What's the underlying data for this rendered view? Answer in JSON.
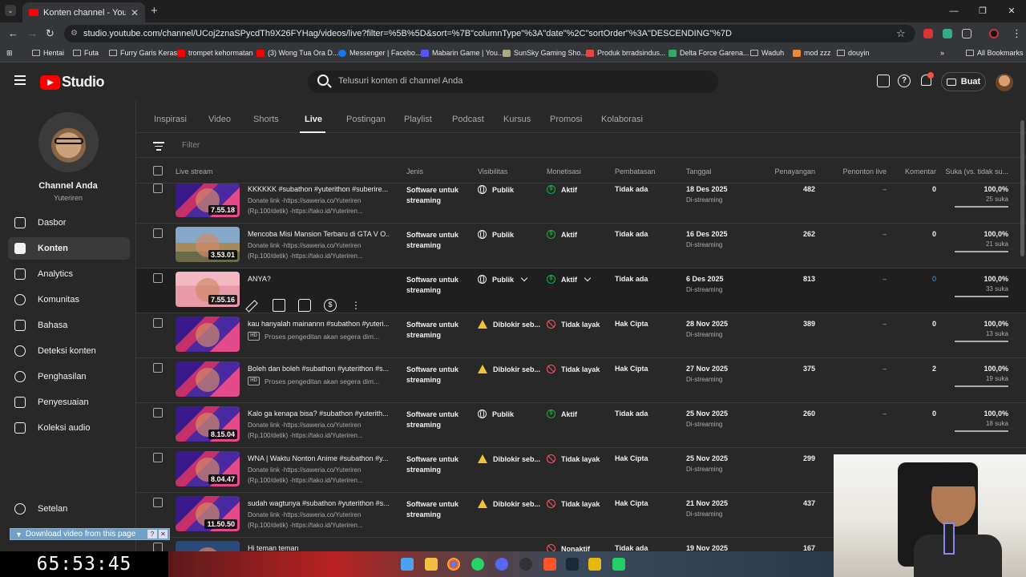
{
  "browser": {
    "tab_title": "Konten channel - YouTube Studio",
    "tab_close": "✕",
    "new_tab": "+",
    "url": "studio.youtube.com/channel/UCoj2znaSPycdTh9X26FYHag/videos/live?filter=%5B%5D&sort=%7B\"columnType\"%3A\"date\"%2C\"sortOrder\"%3A\"DESCENDING\"%7D",
    "bookmarks": [
      "Hentai",
      "Futa",
      "Furry Garis Keras",
      "trompet kehormatan",
      "(3) Wong Tua Ora D...",
      "Messenger | Facebo...",
      "Mabarin Game | You...",
      "SunSky Gaming Sho...",
      "Produk brradsindus...",
      "Delta Force Garena...",
      "Waduh",
      "mod zzz",
      "douyin"
    ],
    "all_bookmarks": "All Bookmarks"
  },
  "studio": {
    "logo_text": "Studio",
    "search_placeholder": "Telusuri konten di channel Anda",
    "create_label": "Buat"
  },
  "sidebar": {
    "channel_name": "Channel Anda",
    "channel_handle": "Yuteriren",
    "items": [
      {
        "label": "Dasbor"
      },
      {
        "label": "Konten"
      },
      {
        "label": "Analytics"
      },
      {
        "label": "Komunitas"
      },
      {
        "label": "Bahasa"
      },
      {
        "label": "Deteksi konten"
      },
      {
        "label": "Penghasilan"
      },
      {
        "label": "Penyesuaian"
      },
      {
        "label": "Koleksi audio"
      }
    ],
    "settings": "Setelan"
  },
  "content_tabs": [
    "Inspirasi",
    "Video",
    "Shorts",
    "Live",
    "Postingan",
    "Playlist",
    "Podcast",
    "Kursus",
    "Promosi",
    "Kolaborasi"
  ],
  "active_tab": "Live",
  "filter_placeholder": "Filter",
  "columns": {
    "live_stream": "Live stream",
    "type": "Jenis",
    "visibility": "Visibilitas",
    "monetization": "Monetisasi",
    "restrictions": "Pembatasan",
    "date": "Tanggal",
    "views": "Penayangan",
    "live_viewers": "Penonton live",
    "comments": "Komentar",
    "likes": "Suka (vs. tidak su..."
  },
  "rows": [
    {
      "thumb": "sub",
      "duration": "7.55.18",
      "title": "KKKKKK #subathon #yuterithon #suberire...",
      "desc": "Donate link -https://saweria.co/Yuteriren\n(Rp.100/detik) -https://tako.id/Yuteriren...",
      "processing": "",
      "type": "Software untuk streaming",
      "visibility": "Publik",
      "vis_icon": "globe",
      "monetization": "Aktif",
      "mon_icon": "on",
      "restriction": "Tidak ada",
      "date": "18 Des 2025",
      "date_sub": "Di-streaming",
      "views": "482",
      "live_viewers": "–",
      "comments": "0",
      "likes": "100,0%",
      "likes_sub": "25 suka",
      "like_ratio": 1.0
    },
    {
      "thumb": "gta",
      "duration": "3.53.01",
      "title": "Mencoba Misi Mansion Terbaru di GTA V O...",
      "desc": "Donate link -https://saweria.co/Yuteriren\n(Rp.100/detik) -https://tako.id/Yuteriren...",
      "processing": "",
      "type": "Software untuk streaming",
      "visibility": "Publik",
      "vis_icon": "globe",
      "monetization": "Aktif",
      "mon_icon": "on",
      "restriction": "Tidak ada",
      "date": "16 Des 2025",
      "date_sub": "Di-streaming",
      "views": "262",
      "live_viewers": "–",
      "comments": "0",
      "likes": "100,0%",
      "likes_sub": "21 suka",
      "like_ratio": 1.0
    },
    {
      "thumb": "anya",
      "duration": "7.55.16",
      "title": "ANYA?",
      "desc": "",
      "processing": "",
      "type": "Software untuk streaming",
      "visibility": "Publik",
      "vis_icon": "globe",
      "monetization": "Aktif",
      "mon_icon": "on",
      "restriction": "Tidak ada",
      "date": "6 Des 2025",
      "date_sub": "Di-streaming",
      "views": "813",
      "live_viewers": "–",
      "comments": "0",
      "likes": "100,0%",
      "likes_sub": "33 suka",
      "like_ratio": 1.0,
      "hover": true
    },
    {
      "thumb": "sub",
      "duration": "",
      "title": "kau hanyalah mainannn #subathon #yuteri...",
      "desc": "",
      "processing": "Proses pengeditan akan segera dim...",
      "type": "Software untuk streaming",
      "visibility": "Diblokir seb...",
      "vis_icon": "warn",
      "monetization": "Tidak layak",
      "mon_icon": "off",
      "restriction": "Hak Cipta",
      "date": "28 Nov 2025",
      "date_sub": "Di-streaming",
      "views": "389",
      "live_viewers": "–",
      "comments": "0",
      "likes": "100,0%",
      "likes_sub": "13 suka",
      "like_ratio": 1.0
    },
    {
      "thumb": "sub",
      "duration": "",
      "title": "Boleh dan boleh #subathon #yuterithon #s...",
      "desc": "",
      "processing": "Proses pengeditan akan segera dim...",
      "type": "Software untuk streaming",
      "visibility": "Diblokir seb...",
      "vis_icon": "warn",
      "monetization": "Tidak layak",
      "mon_icon": "off",
      "restriction": "Hak Cipta",
      "date": "27 Nov 2025",
      "date_sub": "Di-streaming",
      "views": "375",
      "live_viewers": "–",
      "comments": "2",
      "likes": "100,0%",
      "likes_sub": "19 suka",
      "like_ratio": 1.0
    },
    {
      "thumb": "sub",
      "duration": "8.15.04",
      "title": "Kalo ga kenapa bisa? #subathon #yuterith...",
      "desc": "Donate link -https://saweria.co/Yuteriren\n(Rp.100/detik) -https://tako.id/Yuteriren...",
      "processing": "",
      "type": "Software untuk streaming",
      "visibility": "Publik",
      "vis_icon": "globe",
      "monetization": "Aktif",
      "mon_icon": "on",
      "restriction": "Tidak ada",
      "date": "25 Nov 2025",
      "date_sub": "Di-streaming",
      "views": "260",
      "live_viewers": "–",
      "comments": "0",
      "likes": "100,0%",
      "likes_sub": "18 suka",
      "like_ratio": 1.0
    },
    {
      "thumb": "sub",
      "duration": "8.04.47",
      "title": "WNA | Waktu Nonton Anime #subathon #y...",
      "desc": "Donate link -https://saweria.co/Yuteriren\n(Rp.100/detik) -https://tako.id/Yuteriren...",
      "processing": "",
      "type": "Software untuk streaming",
      "visibility": "Diblokir seb...",
      "vis_icon": "warn",
      "monetization": "Tidak layak",
      "mon_icon": "off",
      "restriction": "Hak Cipta",
      "date": "25 Nov 2025",
      "date_sub": "Di-streaming",
      "views": "299",
      "live_viewers": "",
      "comments": "",
      "likes": "",
      "likes_sub": "",
      "like_ratio": null
    },
    {
      "thumb": "sub",
      "duration": "11.50.50",
      "title": "sudah wagtunya #subathon #yuterithon #s...",
      "desc": "Donate link -https://saweria.co/Yuteriren\n(Rp.100/detik) -https://tako.id/Yuteriren...",
      "processing": "",
      "type": "Software untuk streaming",
      "visibility": "Diblokir seb...",
      "vis_icon": "warn",
      "monetization": "Tidak layak",
      "mon_icon": "off",
      "restriction": "Hak Cipta",
      "date": "21 Nov 2025",
      "date_sub": "Di-streaming",
      "views": "437",
      "live_viewers": "",
      "comments": "",
      "likes": "",
      "likes_sub": "",
      "like_ratio": null
    },
    {
      "thumb": "dark",
      "duration": "",
      "title": "Hi teman teman",
      "desc": "",
      "processing": "",
      "type": "",
      "visibility": "",
      "vis_icon": "globe",
      "monetization": "Nonaktif",
      "mon_icon": "off",
      "restriction": "Tidak ada",
      "date": "19 Nov 2025",
      "date_sub": "",
      "views": "167",
      "live_viewers": "",
      "comments": "",
      "likes": "",
      "likes_sub": "",
      "like_ratio": null
    }
  ],
  "download_bar": {
    "label": "Download video from this page",
    "help": "?",
    "close": "✕"
  },
  "timer": "65:53:45"
}
